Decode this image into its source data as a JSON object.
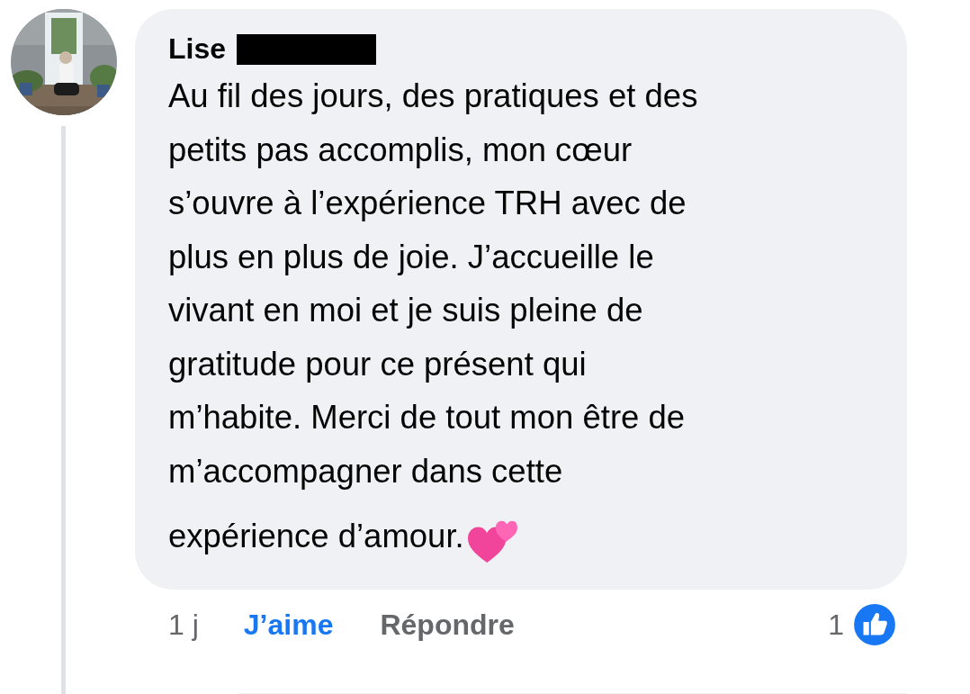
{
  "comment": {
    "author": "Lise",
    "author_redacted": true,
    "message_lines": [
      "Au fil des jours, des pratiques et des",
      "petits pas accomplis, mon cœur",
      "s’ouvre à l’expérience TRH avec de",
      "plus en plus de joie. J’accueille le",
      "vivant en moi et je suis pleine de",
      "gratitude pour ce présent qui",
      "m’habite. Merci de tout mon être de",
      "m’accompagner dans cette",
      "expérience d’amour."
    ],
    "time": "1 j",
    "like_label": "J’aime",
    "liked": true,
    "reply_label": "Répondre",
    "reaction_count": "1"
  }
}
